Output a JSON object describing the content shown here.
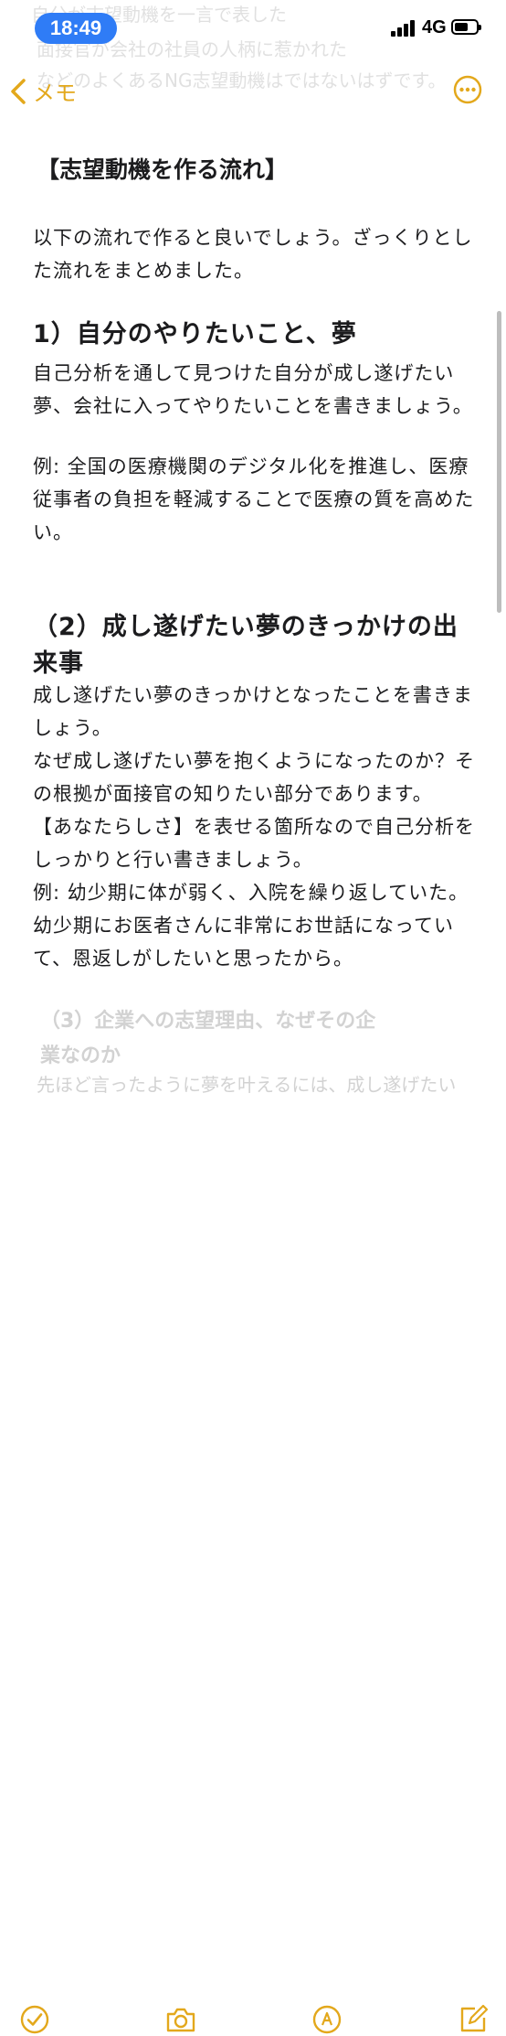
{
  "status": {
    "time": "18:49",
    "network": "4G"
  },
  "ghost_lines": [
    "自分が志望動機を一言で表した",
    "面接官が会社の社員の人柄に惹かれた",
    "などのよくあるNG志望動機はではないはずです。"
  ],
  "nav": {
    "back_label": "メモ"
  },
  "note": {
    "title": "【志望動機を作る流れ】",
    "intro": "以下の流れで作ると良いでしょう。ざっくりとした流れをまとめました。",
    "section1": {
      "heading": "1）自分のやりたいこと、夢",
      "body": "自己分析を通して見つけた自分が成し遂げたい夢、会社に入ってやりたいことを書きましょう。",
      "example": "例: 全国の医療機関のデジタル化を推進し、医療従事者の負担を軽減することで医療の質を高めたい。"
    },
    "section2": {
      "heading": "（2）成し遂げたい夢のきっかけの出来事",
      "body1": "成し遂げたい夢のきっかけとなったことを書きましょう。",
      "body2": "なぜ成し遂げたい夢を抱くようになったのか？その根拠が面接官の知りたい部分であります。",
      "body3": "【あなたらしさ】を表せる箇所なので自己分析をしっかりと行い書きましょう。",
      "example": "例: 幼少期に体が弱く、入院を繰り返していた。幼少期にお医者さんに非常にお世話になっていて、恩返しがしたいと思ったから。"
    },
    "section3_partial": {
      "heading_line1": "（3）企業への志望理由、なぜその企",
      "heading_line2": "業なのか",
      "body_partial": "先ほど言ったように夢を叶えるには、成し遂げたい"
    }
  },
  "toolbar": {
    "icons": [
      "checklist-icon",
      "camera-icon",
      "markup-icon",
      "compose-icon"
    ]
  },
  "colors": {
    "accent": "#e3a81c",
    "time_pill": "#2f7cf6",
    "text": "#1c1c1e"
  }
}
